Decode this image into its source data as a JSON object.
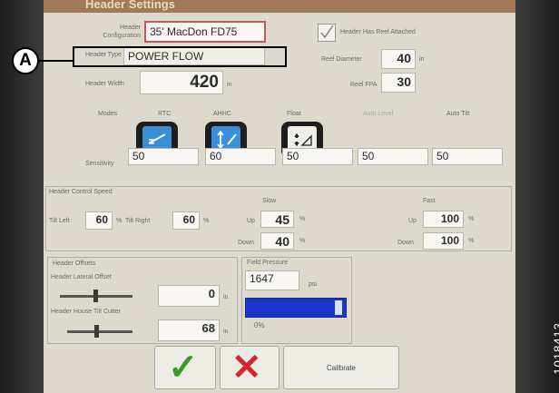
{
  "window": {
    "title": "Header Settings"
  },
  "header_config": {
    "label": "Header Configuration",
    "value": "35' MacDon FD75"
  },
  "reel_attached": {
    "label": "Header Has Reel Attached",
    "checked": true
  },
  "header_type": {
    "label": "Header Type",
    "value": "POWER FLOW"
  },
  "reel_diameter": {
    "label": "Reel Diameter",
    "value": "40",
    "unit": "in"
  },
  "header_width": {
    "label": "Header Width",
    "value": "420",
    "unit": "in"
  },
  "reel_fpa": {
    "label": "Reel FPA",
    "value": "30"
  },
  "modes": {
    "label": "Modes",
    "items": [
      {
        "label": "RTC",
        "active": true
      },
      {
        "label": "AHHC",
        "active": true
      },
      {
        "label": "Float",
        "active": false
      },
      {
        "label": "Auto Level",
        "active": false
      },
      {
        "label": "Auto Tilt",
        "active": false
      }
    ]
  },
  "sensitivity": {
    "label": "Sensitivity",
    "values": [
      "50",
      "60",
      "50",
      "50",
      "50"
    ]
  },
  "header_control_speed": {
    "label": "Header Control Speed",
    "tilt_left": {
      "label": "Tilt Left",
      "value": "60",
      "unit": "%"
    },
    "tilt_right": {
      "label": "Tilt Right",
      "value": "60",
      "unit": "%"
    },
    "slow": {
      "label": "Slow",
      "up_label": "Up",
      "up": "45",
      "down_label": "Down",
      "down": "40",
      "unit": "%"
    },
    "fast": {
      "label": "Fast",
      "up_label": "Up",
      "up": "100",
      "down_label": "Down",
      "down": "100",
      "unit": "%"
    }
  },
  "header_offsets": {
    "label": "Header Offsets",
    "lateral": {
      "label": "Header Lateral Offset",
      "value": "0",
      "unit": "in"
    },
    "tilt": {
      "label": "Header House Tilt Cutter",
      "value": "68",
      "unit": "in"
    }
  },
  "field_pressure": {
    "label": "Field Pressure",
    "value": "1647",
    "unit": "psi",
    "bar_label": "0%"
  },
  "buttons": {
    "ok": "✓",
    "cancel": "✕",
    "calibrate": "Calibrate"
  },
  "callout": {
    "letter": "A"
  },
  "figure_id": "1018413",
  "colors": {
    "accent_blue": "#3a8fd9",
    "ok_green": "#3a9a2a",
    "cancel_red": "#d1262a",
    "title_bar": "#a07a56"
  }
}
